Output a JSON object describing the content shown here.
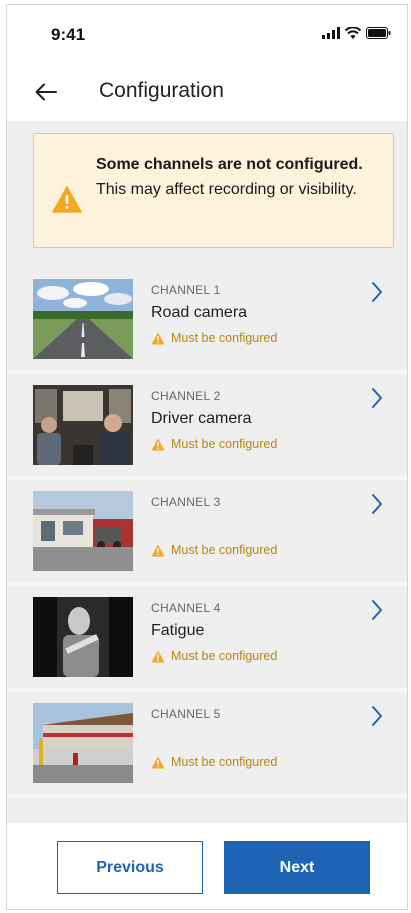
{
  "status_bar": {
    "time": "9:41",
    "icons": [
      "signal-icon",
      "wifi-icon",
      "battery-icon"
    ]
  },
  "header": {
    "back_icon": "arrow-left-icon",
    "title": "Configuration"
  },
  "banner": {
    "icon": "warning-icon",
    "bold_text": "Some channels are not configured.",
    "body_text": "This may affect recording or visibility."
  },
  "channels": [
    {
      "number": "CHANNEL 1",
      "name": "Road camera",
      "status": "Must be configured",
      "thumbnail": "road-scene"
    },
    {
      "number": "CHANNEL 2",
      "name": "Driver camera",
      "status": "Must be configured",
      "thumbnail": "cab-interior"
    },
    {
      "number": "CHANNEL 3",
      "name": "",
      "status": "Must be configured",
      "thumbnail": "street-building"
    },
    {
      "number": "CHANNEL 4",
      "name": "Fatigue",
      "status": "Must be configured",
      "thumbnail": "driver-infrared"
    },
    {
      "number": "CHANNEL 5",
      "name": "",
      "status": "Must be configured",
      "thumbnail": "depot-building"
    }
  ],
  "footer": {
    "previous_label": "Previous",
    "next_label": "Next"
  },
  "colors": {
    "primary": "#1f64b4",
    "warning": "#f5a623",
    "warning_text": "#b8860b",
    "banner_bg": "#fdf2dc",
    "banner_border": "#f0c774"
  }
}
